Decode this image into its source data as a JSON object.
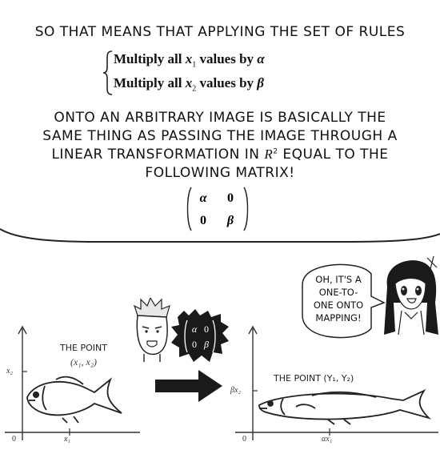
{
  "caption": {
    "intro": "SO THAT MEANS THAT APPLYING THE SET OF RULES",
    "rule1": {
      "prefix": "Multiply all ",
      "var": "x",
      "sub": "1",
      "mid": " values by ",
      "factor": "α"
    },
    "rule2": {
      "prefix": "Multiply all ",
      "var": "x",
      "sub": "2",
      "mid": " values by ",
      "factor": "β"
    },
    "body_line1": "ONTO AN ARBITRARY IMAGE IS BASICALLY THE",
    "body_line2": "SAME THING AS PASSING THE IMAGE THROUGH A",
    "body_line3_a": "LINEAR TRANSFORMATION IN ",
    "body_line3_r": "R",
    "body_line3_sup": "2",
    "body_line3_b": " EQUAL TO THE",
    "body_line4": "FOLLOWING MATRIX!",
    "matrix": [
      "α",
      "0",
      "0",
      "β"
    ]
  },
  "left_plot": {
    "point_label": "THE POINT",
    "point_coords": "(x₁, x₂)",
    "y_label": "x₂",
    "x_label": "x₁",
    "origin": "0"
  },
  "right_plot": {
    "point_label": "THE POINT (y₁, y₂)",
    "y_label": "βx₂",
    "x_label": "αx₁",
    "origin": "0"
  },
  "head_matrix": [
    "α",
    "0",
    "0",
    "β"
  ],
  "speech_bubble": {
    "lines": [
      "OH, IT'S A",
      "ONE-TO-",
      "ONE ONTO",
      "MAPPING!"
    ]
  }
}
